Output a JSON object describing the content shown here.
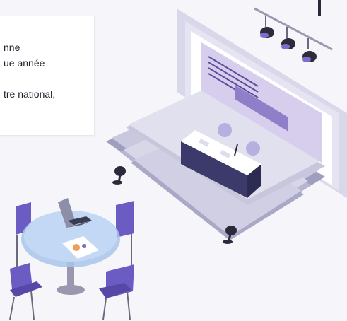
{
  "text_lines": [
    "nne",
    "ue année",
    "tre national,"
  ],
  "colors": {
    "background": "#f6f5fa",
    "stage": "#c9c8de",
    "screen": "#d9d1ec",
    "accent": "#6b5bb0",
    "chairs": "#6b5cc4",
    "table": "#a9c5ea",
    "dark": "#2a2a3a"
  },
  "icons": [
    "spotlight-icon",
    "camera-icon",
    "laptop-icon",
    "pie-chart-icon",
    "microphone-icon"
  ]
}
